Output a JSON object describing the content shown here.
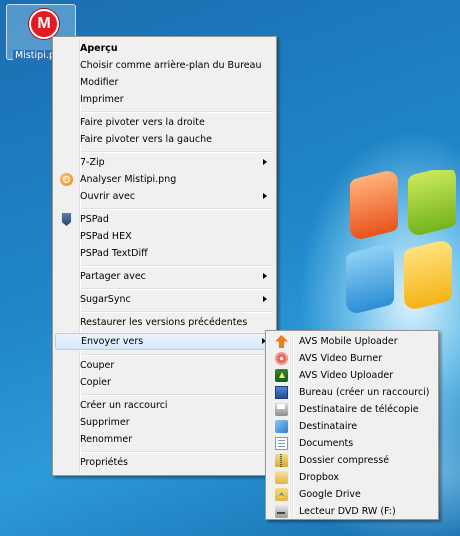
{
  "desktop": {
    "icon": {
      "label": "Mistipi.png",
      "glyph": "M",
      "icon": "mistipi-logo-icon"
    }
  },
  "context_menu": {
    "items": [
      {
        "label": "Aperçu",
        "bold": true
      },
      {
        "label": "Choisir comme arrière-plan du Bureau"
      },
      {
        "label": "Modifier"
      },
      {
        "label": "Imprimer"
      },
      {
        "label": "Faire pivoter vers la droite"
      },
      {
        "label": "Faire pivoter vers la gauche"
      },
      {
        "label": "7-Zip",
        "submenu": true
      },
      {
        "label": "Analyser Mistipi.png",
        "icon": "analyse-icon"
      },
      {
        "label": "Ouvrir avec",
        "submenu": true
      },
      {
        "label": "PSPad",
        "icon": "pspad-icon"
      },
      {
        "label": "PSPad HEX"
      },
      {
        "label": "PSPad TextDiff"
      },
      {
        "label": "Partager avec",
        "submenu": true
      },
      {
        "label": "SugarSync",
        "submenu": true
      },
      {
        "label": "Restaurer les versions précédentes"
      },
      {
        "label": "Envoyer vers",
        "submenu": true,
        "highlighted": true
      },
      {
        "label": "Couper"
      },
      {
        "label": "Copier"
      },
      {
        "label": "Créer un raccourci"
      },
      {
        "label": "Supprimer"
      },
      {
        "label": "Renommer"
      },
      {
        "label": "Propriétés"
      }
    ]
  },
  "send_to_menu": {
    "items": [
      {
        "label": "AVS Mobile Uploader",
        "icon": "upload-arrow-icon"
      },
      {
        "label": "AVS Video Burner",
        "icon": "disc-burner-icon"
      },
      {
        "label": "AVS Video Uploader",
        "icon": "video-uploader-icon"
      },
      {
        "label": "Bureau (créer un raccourci)",
        "icon": "desktop-icon"
      },
      {
        "label": "Destinataire de télécopie",
        "icon": "fax-icon"
      },
      {
        "label": "Destinataire",
        "icon": "mail-recipient-icon"
      },
      {
        "label": "Documents",
        "icon": "documents-icon"
      },
      {
        "label": "Dossier compressé",
        "icon": "zip-folder-icon"
      },
      {
        "label": "Dropbox",
        "icon": "dropbox-folder-icon"
      },
      {
        "label": "Google Drive",
        "icon": "google-drive-icon"
      },
      {
        "label": "Lecteur DVD RW (F:)",
        "icon": "dvd-drive-icon"
      }
    ]
  },
  "colors": {
    "menu_background": "#f0f0f0",
    "menu_border": "#979797",
    "highlight": "#d7e8fb",
    "highlight_border": "#aecff7",
    "desktop_blue": "#1f7fc0"
  }
}
